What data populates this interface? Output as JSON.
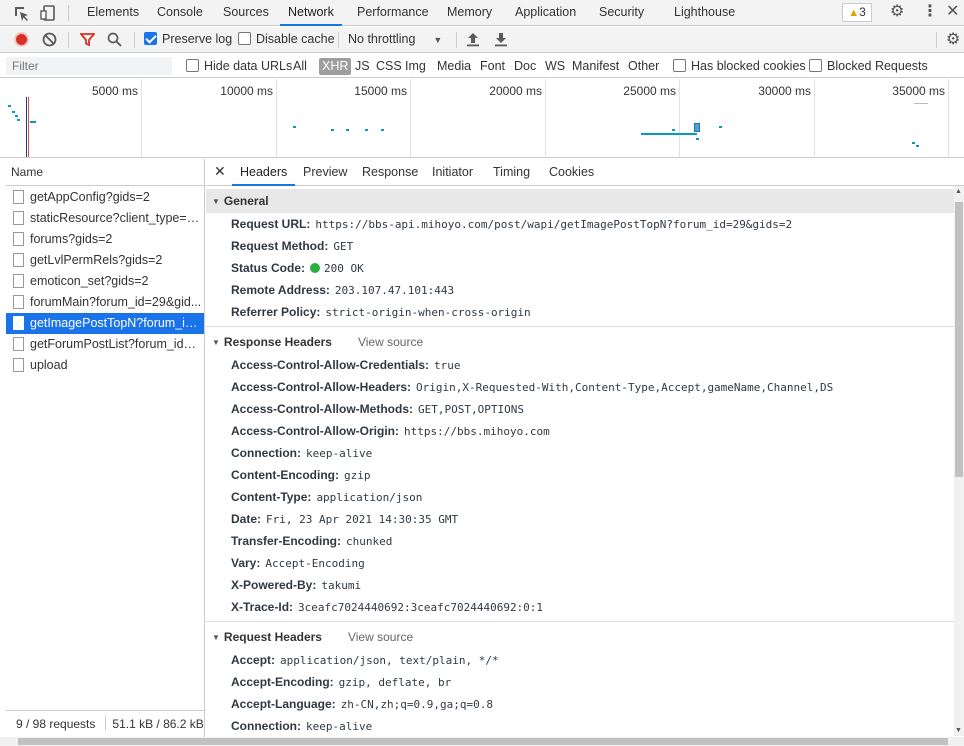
{
  "topbar": {
    "tabs": [
      "Elements",
      "Console",
      "Sources",
      "Network",
      "Performance",
      "Memory",
      "Application",
      "Security",
      "Lighthouse"
    ],
    "active_tab": "Network",
    "warning_count": "3"
  },
  "toolbar": {
    "preserve_log": "Preserve log",
    "disable_cache": "Disable cache",
    "throttling": "No throttling"
  },
  "filterbar": {
    "filter_placeholder": "Filter",
    "hide_data_urls": "Hide data URLs",
    "types": [
      "All",
      "XHR",
      "JS",
      "CSS",
      "Img",
      "Media",
      "Font",
      "Doc",
      "WS",
      "Manifest",
      "Other"
    ],
    "active_type": "XHR",
    "has_blocked_cookies": "Has blocked cookies",
    "blocked_requests": "Blocked Requests"
  },
  "overview": {
    "ticks": [
      "5000 ms",
      "10000 ms",
      "15000 ms",
      "20000 ms",
      "25000 ms",
      "30000 ms",
      "35000 ms"
    ]
  },
  "requests": {
    "header": "Name",
    "items": [
      "getAppConfig?gids=2",
      "staticResource?client_type=4...",
      "forums?gids=2",
      "getLvlPermRels?gids=2",
      "emoticon_set?gids=2",
      "forumMain?forum_id=29&gid...",
      "getImagePostTopN?forum_id...",
      "getForumPostList?forum_id=2...",
      "upload"
    ],
    "selected_index": 6,
    "status_count": "9 / 98 requests",
    "status_size": "51.1 kB / 86.2 kB"
  },
  "detail_tabs": [
    "Headers",
    "Preview",
    "Response",
    "Initiator",
    "Timing",
    "Cookies"
  ],
  "general": {
    "title": "General",
    "request_url_k": "Request URL:",
    "request_url_v": "https://bbs-api.mihoyo.com/post/wapi/getImagePostTopN?forum_id=29&gids=2",
    "method_k": "Request Method:",
    "method_v": "GET",
    "status_k": "Status Code:",
    "status_v": "200 OK",
    "remote_k": "Remote Address:",
    "remote_v": "203.107.47.101:443",
    "referrer_k": "Referrer Policy:",
    "referrer_v": "strict-origin-when-cross-origin"
  },
  "response_headers": {
    "title": "Response Headers",
    "view_source": "View source",
    "items": [
      {
        "k": "Access-Control-Allow-Credentials:",
        "v": "true"
      },
      {
        "k": "Access-Control-Allow-Headers:",
        "v": "Origin,X-Requested-With,Content-Type,Accept,gameName,Channel,DS"
      },
      {
        "k": "Access-Control-Allow-Methods:",
        "v": "GET,POST,OPTIONS"
      },
      {
        "k": "Access-Control-Allow-Origin:",
        "v": "https://bbs.mihoyo.com"
      },
      {
        "k": "Connection:",
        "v": "keep-alive"
      },
      {
        "k": "Content-Encoding:",
        "v": "gzip"
      },
      {
        "k": "Content-Type:",
        "v": "application/json"
      },
      {
        "k": "Date:",
        "v": "Fri, 23 Apr 2021 14:30:35 GMT"
      },
      {
        "k": "Transfer-Encoding:",
        "v": "chunked"
      },
      {
        "k": "Vary:",
        "v": "Accept-Encoding"
      },
      {
        "k": "X-Powered-By:",
        "v": "takumi"
      },
      {
        "k": "X-Trace-Id:",
        "v": "3ceafc7024440692:3ceafc7024440692:0:1"
      }
    ]
  },
  "request_headers": {
    "title": "Request Headers",
    "view_source": "View source",
    "items": [
      {
        "k": "Accept:",
        "v": "application/json, text/plain, */*"
      },
      {
        "k": "Accept-Encoding:",
        "v": "gzip, deflate, br"
      },
      {
        "k": "Accept-Language:",
        "v": "zh-CN,zh;q=0.9,ga;q=0.8"
      },
      {
        "k": "Connection:",
        "v": "keep-alive"
      }
    ]
  }
}
